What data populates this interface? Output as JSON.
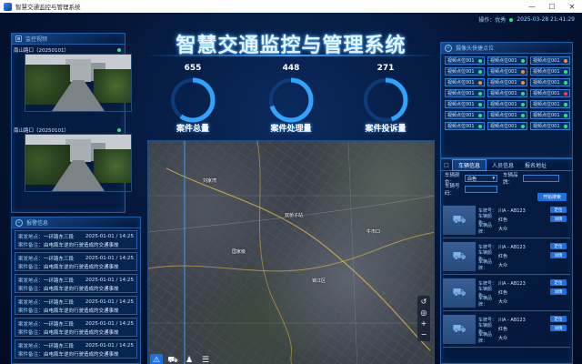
{
  "window": {
    "title": "智慧交通监控与管理系统"
  },
  "status": {
    "user": "操作：优秀",
    "datetime": "2025-03-28 21:41:29"
  },
  "header": {
    "title": "智慧交通监控与管理系统"
  },
  "stats": [
    {
      "value": "655",
      "label": "案件总量",
      "fraction": 0.6
    },
    {
      "value": "448",
      "label": "案件处理量",
      "fraction": 0.7
    },
    {
      "value": "271",
      "label": "案件投诉量",
      "fraction": 0.45
    }
  ],
  "cameras": {
    "title": "监控视频",
    "items": [
      {
        "caption": "南山路口（20250101）"
      },
      {
        "caption": "南山路口（20250101）"
      }
    ]
  },
  "alerts": {
    "title": "报警信息",
    "location_label": "案发地点：",
    "note_label": "案件备注：",
    "items": [
      {
        "location": "一环路东三段",
        "time": "2025-01-01 / 14:25",
        "note": "由电瓶车逆向行驶造成的交通事故"
      },
      {
        "location": "一环路东三段",
        "time": "2025-01-01 / 14:25",
        "note": "由电瓶车逆向行驶造成的交通事故"
      },
      {
        "location": "一环路东三段",
        "time": "2025-01-01 / 14:25",
        "note": "由电瓶车逆向行驶造成的交通事故"
      },
      {
        "location": "一环路东三段",
        "time": "2025-01-01 / 14:25",
        "note": "由电瓶车逆向行驶造成的交通事故"
      },
      {
        "location": "一环路东三段",
        "time": "2025-01-01 / 14:25",
        "note": "由电瓶车逆向行驶造成的交通事故"
      },
      {
        "location": "一环路东三段",
        "time": "2025-01-01 / 14:25",
        "note": "由电瓶车逆向行驶造成的交通事故"
      }
    ]
  },
  "camera_grid": {
    "title": "摄像头快捷点位",
    "cells": [
      {
        "label": "视频点位001",
        "color": "#35e07a"
      },
      {
        "label": "视频点位001",
        "color": "#35e07a"
      },
      {
        "label": "视频点位001",
        "color": "#ff8a2a"
      },
      {
        "label": "视频点位001",
        "color": "#35e07a"
      },
      {
        "label": "视频点位001",
        "color": "#ff8a2a"
      },
      {
        "label": "视频点位001",
        "color": "#35e07a"
      },
      {
        "label": "视频点位001",
        "color": "#ff8a2a"
      },
      {
        "label": "视频点位001",
        "color": "#ff8a2a"
      },
      {
        "label": "视频点位001",
        "color": "#35e07a"
      },
      {
        "label": "视频点位001",
        "color": "#35e07a"
      },
      {
        "label": "视频点位001",
        "color": "#35e07a"
      },
      {
        "label": "视频点位001",
        "color": "#ff3a3a"
      },
      {
        "label": "视频点位001",
        "color": "#35e07a"
      },
      {
        "label": "视频点位001",
        "color": "#35e07a"
      },
      {
        "label": "视频点位001",
        "color": "#35e07a"
      },
      {
        "label": "视频点位001",
        "color": "#35e07a"
      },
      {
        "label": "视频点位001",
        "color": "#35e07a"
      },
      {
        "label": "视频点位001",
        "color": "#35e07a"
      },
      {
        "label": "视频点位001",
        "color": "#35e07a"
      },
      {
        "label": "视频点位001",
        "color": "#35e07a"
      },
      {
        "label": "视频点位001",
        "color": "#35e07a"
      }
    ]
  },
  "vehicle_panel": {
    "tabs": [
      "车辆信息",
      "人员信息",
      "报名地址"
    ],
    "form": {
      "color_label": "车辆颜色：",
      "color_value": "白色",
      "brand_label": "车辆品牌：",
      "plate_label": "车辆号码：",
      "search_label": "开始搜索"
    },
    "labels": {
      "plate": "车牌号：",
      "color": "车辆颜色：",
      "brand": "车辆品牌：",
      "locate": "定位",
      "detail": "详情"
    },
    "items": [
      {
        "plate": "川A - AB123",
        "color": "红色",
        "brand": "大众"
      },
      {
        "plate": "川A - AB123",
        "color": "红色",
        "brand": "大众"
      },
      {
        "plate": "川A - AB123",
        "color": "红色",
        "brand": "大众"
      },
      {
        "plate": "川A - AB123",
        "color": "红色",
        "brand": "大众"
      }
    ]
  },
  "map": {
    "labels": [
      "刘家湾",
      "双桥子站",
      "国家级",
      "锦江区",
      "牛市口"
    ]
  },
  "colors": {
    "accent": "#3aa0ff",
    "panel_border": "#1f5fa8",
    "button": "#1e6fe0"
  }
}
